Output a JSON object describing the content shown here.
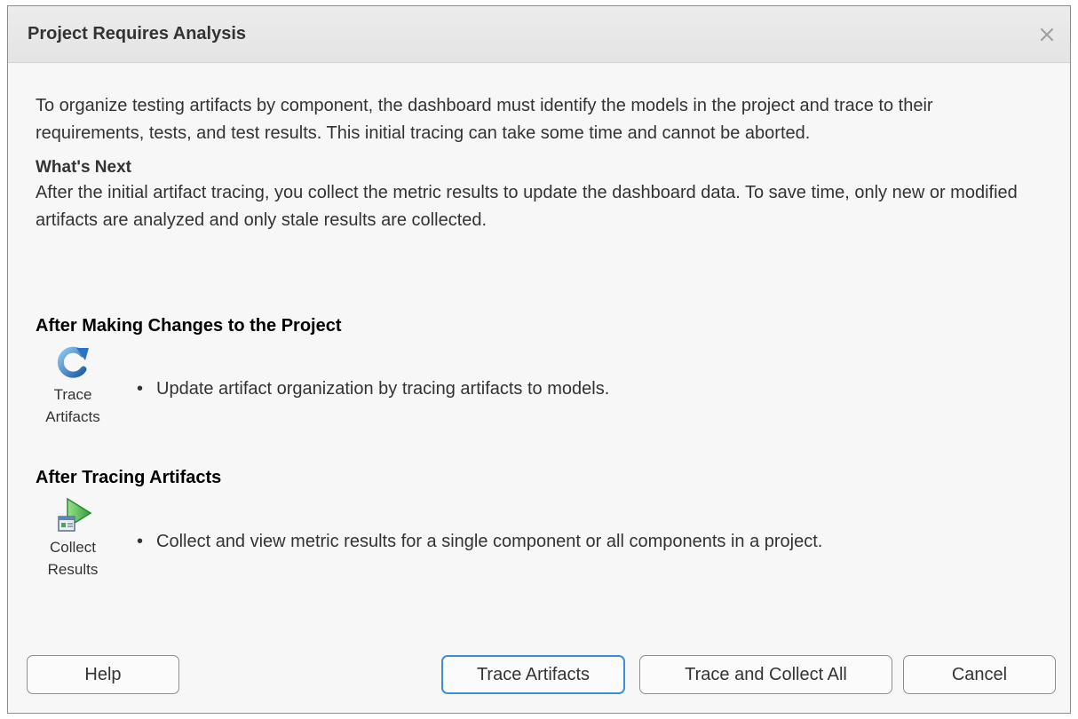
{
  "dialog": {
    "title": "Project Requires Analysis",
    "close_symbol": "×"
  },
  "intro": "To organize testing artifacts by component, the dashboard must identify the models in the project and trace to their requirements, tests, and test results. This initial tracing can take some time and cannot be aborted.",
  "whats_next": {
    "heading": "What's Next",
    "text": "After the initial artifact tracing, you collect the metric results to update the dashboard data. To save time, only new or modified artifacts are analyzed and only stale results are collected."
  },
  "sections": [
    {
      "heading": "After Making Changes to the Project",
      "tool_label_line1": "Trace",
      "tool_label_line2": "Artifacts",
      "tool_icon": "trace-artifacts-icon",
      "bullet": "Update artifact organization by tracing artifacts to models."
    },
    {
      "heading": "After Tracing Artifacts",
      "tool_label_line1": "Collect",
      "tool_label_line2": "Results",
      "tool_icon": "collect-results-icon",
      "bullet": "Collect and view metric results for a single component or all components in a project."
    }
  ],
  "buttons": {
    "help": "Help",
    "trace_artifacts": "Trace Artifacts",
    "trace_collect_all": "Trace and Collect All",
    "cancel": "Cancel"
  },
  "colors": {
    "accent_focus": "#3f8fd6",
    "icon_blue": "#2a73c4",
    "icon_green": "#3cb043"
  }
}
